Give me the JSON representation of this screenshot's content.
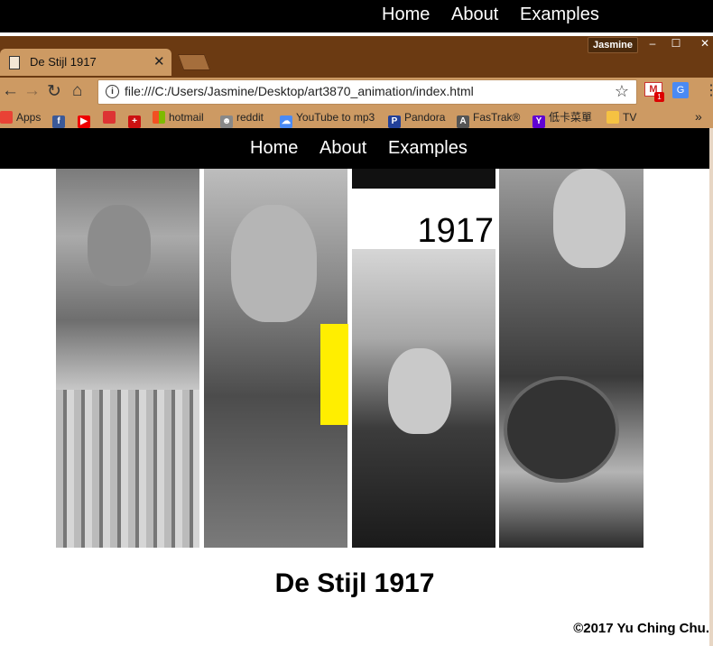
{
  "outer_nav": {
    "home": "Home",
    "about": "About",
    "examples": "Examples"
  },
  "window": {
    "profile": "Jasmine",
    "min": "‒",
    "max": "☐",
    "close": "✕"
  },
  "tab": {
    "title": "De Stijl 1917",
    "close": "✕"
  },
  "toolbar": {
    "url": "file:///C:/Users/Jasmine/Desktop/art3870_animation/index.html",
    "gmail_badge": "1"
  },
  "bookmarks": [
    {
      "label": "Apps",
      "icon": "apps-icon",
      "color": "#e94235"
    },
    {
      "label": "",
      "icon": "facebook-icon",
      "color": "#3b5998"
    },
    {
      "label": "",
      "icon": "youtube-icon",
      "color": "#e00"
    },
    {
      "label": "",
      "icon": "bank-icon",
      "color": "#d33"
    },
    {
      "label": "",
      "icon": "flag-icon",
      "color": "#c11"
    },
    {
      "label": "hotmail",
      "icon": "windows-icon",
      "color": "#f25022"
    },
    {
      "label": "reddit",
      "icon": "reddit-icon",
      "color": "#ff4500"
    },
    {
      "label": "YouTube to mp3",
      "icon": "cloud-icon",
      "color": "#4a8af4"
    },
    {
      "label": "Pandora",
      "icon": "pandora-icon",
      "color": "#224099"
    },
    {
      "label": "FasTrak®",
      "icon": "fastrak-icon",
      "color": "#555"
    },
    {
      "label": "低卡菜單",
      "icon": "yahoo-icon",
      "color": "#6001d2"
    },
    {
      "label": "TV",
      "icon": "folder-icon",
      "color": "#f5c242"
    }
  ],
  "inner_nav": {
    "home": "Home",
    "about": "About",
    "examples": "Examples"
  },
  "panel_year": "1917",
  "page_title": "De Stijl 1917",
  "footer": "©2017 Yu Ching Chu."
}
